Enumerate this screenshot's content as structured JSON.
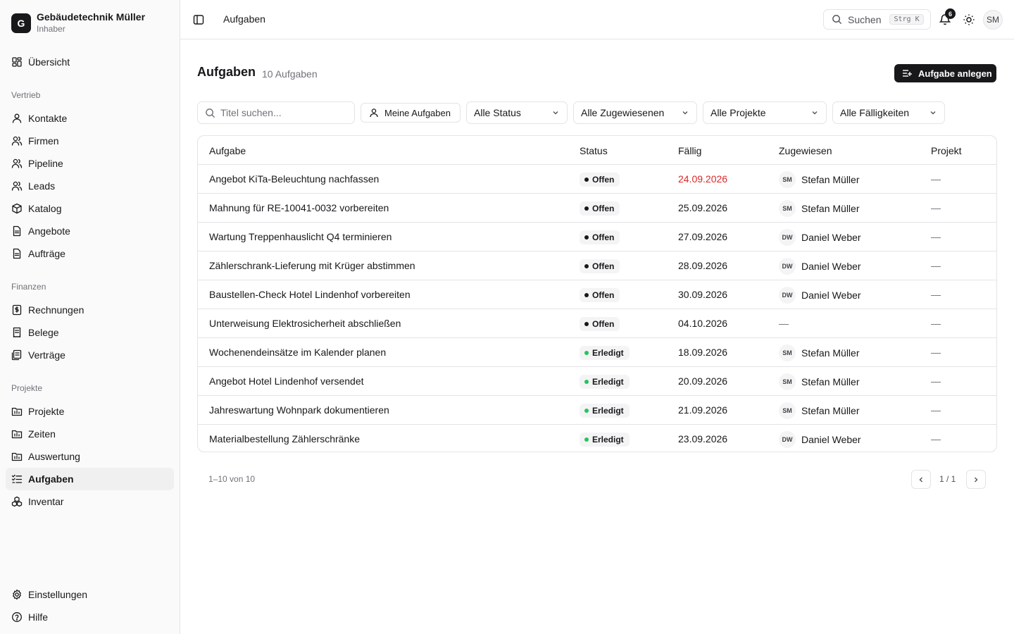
{
  "brand": {
    "initial": "G",
    "name": "Gebäudetechnik Müller",
    "role": "Inhaber"
  },
  "sidebar": {
    "overview": {
      "label": "Übersicht",
      "icon": "dashboard-icon"
    },
    "groups": [
      {
        "title": "Vertrieb",
        "items": [
          {
            "label": "Kontakte",
            "icon": "user-icon"
          },
          {
            "label": "Firmen",
            "icon": "users-icon"
          },
          {
            "label": "Pipeline",
            "icon": "users-icon"
          },
          {
            "label": "Leads",
            "icon": "users-icon"
          },
          {
            "label": "Katalog",
            "icon": "package-icon"
          },
          {
            "label": "Angebote",
            "icon": "file-icon"
          },
          {
            "label": "Aufträge",
            "icon": "file-icon"
          }
        ]
      },
      {
        "title": "Finanzen",
        "items": [
          {
            "label": "Rechnungen",
            "icon": "invoice-icon"
          },
          {
            "label": "Belege",
            "icon": "receipt-icon"
          },
          {
            "label": "Verträge",
            "icon": "contract-icon"
          }
        ]
      },
      {
        "title": "Projekte",
        "items": [
          {
            "label": "Projekte",
            "icon": "folder-icon"
          },
          {
            "label": "Zeiten",
            "icon": "folder-icon"
          },
          {
            "label": "Auswertung",
            "icon": "folder-icon"
          },
          {
            "label": "Aufgaben",
            "icon": "tasks-icon",
            "active": true
          },
          {
            "label": "Inventar",
            "icon": "boxes-icon"
          }
        ]
      }
    ],
    "bottom": [
      {
        "label": "Einstellungen",
        "icon": "gear-icon"
      },
      {
        "label": "Hilfe",
        "icon": "help-icon"
      }
    ]
  },
  "topbar": {
    "title": "Aufgaben",
    "search_label": "Suchen",
    "search_shortcut": "Strg K",
    "notification_count": "6",
    "user_initials": "SM"
  },
  "page": {
    "title": "Aufgaben",
    "count": "10 Aufgaben",
    "create_label": "Aufgabe anlegen"
  },
  "filters": {
    "search_placeholder": "Titel suchen...",
    "mine_label": "Meine Aufgaben",
    "status": "Alle Status",
    "assignee": "Alle Zugewiesenen",
    "project": "Alle Projekte",
    "due": "Alle Fälligkeiten"
  },
  "table": {
    "columns": [
      "Aufgabe",
      "Status",
      "Fällig",
      "Zugewiesen",
      "Projekt"
    ],
    "rows": [
      {
        "title": "Angebot KiTa-Beleuchtung nachfassen",
        "status": "Offen",
        "due": "24.09.2026",
        "overdue": true,
        "initials": "SM",
        "assignee": "Stefan Müller",
        "project": "—"
      },
      {
        "title": "Mahnung für RE-10041-0032 vorbereiten",
        "status": "Offen",
        "due": "25.09.2026",
        "overdue": false,
        "initials": "SM",
        "assignee": "Stefan Müller",
        "project": "—"
      },
      {
        "title": "Wartung Treppenhauslicht Q4 terminieren",
        "status": "Offen",
        "due": "27.09.2026",
        "overdue": false,
        "initials": "DW",
        "assignee": "Daniel Weber",
        "project": "—"
      },
      {
        "title": "Zählerschrank-Lieferung mit Krüger abstimmen",
        "status": "Offen",
        "due": "28.09.2026",
        "overdue": false,
        "initials": "DW",
        "assignee": "Daniel Weber",
        "project": "—"
      },
      {
        "title": "Baustellen-Check Hotel Lindenhof vorbereiten",
        "status": "Offen",
        "due": "30.09.2026",
        "overdue": false,
        "initials": "DW",
        "assignee": "Daniel Weber",
        "project": "—"
      },
      {
        "title": "Unterweisung Elektrosicherheit abschließen",
        "status": "Offen",
        "due": "04.10.2026",
        "overdue": false,
        "initials": "",
        "assignee": "—",
        "project": "—"
      },
      {
        "title": "Wochenendeinsätze im Kalender planen",
        "status": "Erledigt",
        "due": "18.09.2026",
        "overdue": false,
        "initials": "SM",
        "assignee": "Stefan Müller",
        "project": "—"
      },
      {
        "title": "Angebot Hotel Lindenhof versendet",
        "status": "Erledigt",
        "due": "20.09.2026",
        "overdue": false,
        "initials": "SM",
        "assignee": "Stefan Müller",
        "project": "—"
      },
      {
        "title": "Jahreswartung Wohnpark dokumentieren",
        "status": "Erledigt",
        "due": "21.09.2026",
        "overdue": false,
        "initials": "SM",
        "assignee": "Stefan Müller",
        "project": "—"
      },
      {
        "title": "Materialbestellung Zählerschränke",
        "status": "Erledigt",
        "due": "23.09.2026",
        "overdue": false,
        "initials": "DW",
        "assignee": "Daniel Weber",
        "project": "—"
      }
    ]
  },
  "pagination": {
    "range": "1–10 von 10",
    "page": "1 / 1"
  },
  "colors": {
    "open_dot": "#18181b",
    "done_dot": "#22c55e",
    "overdue": "#dc2626",
    "primary": "#18181b"
  }
}
